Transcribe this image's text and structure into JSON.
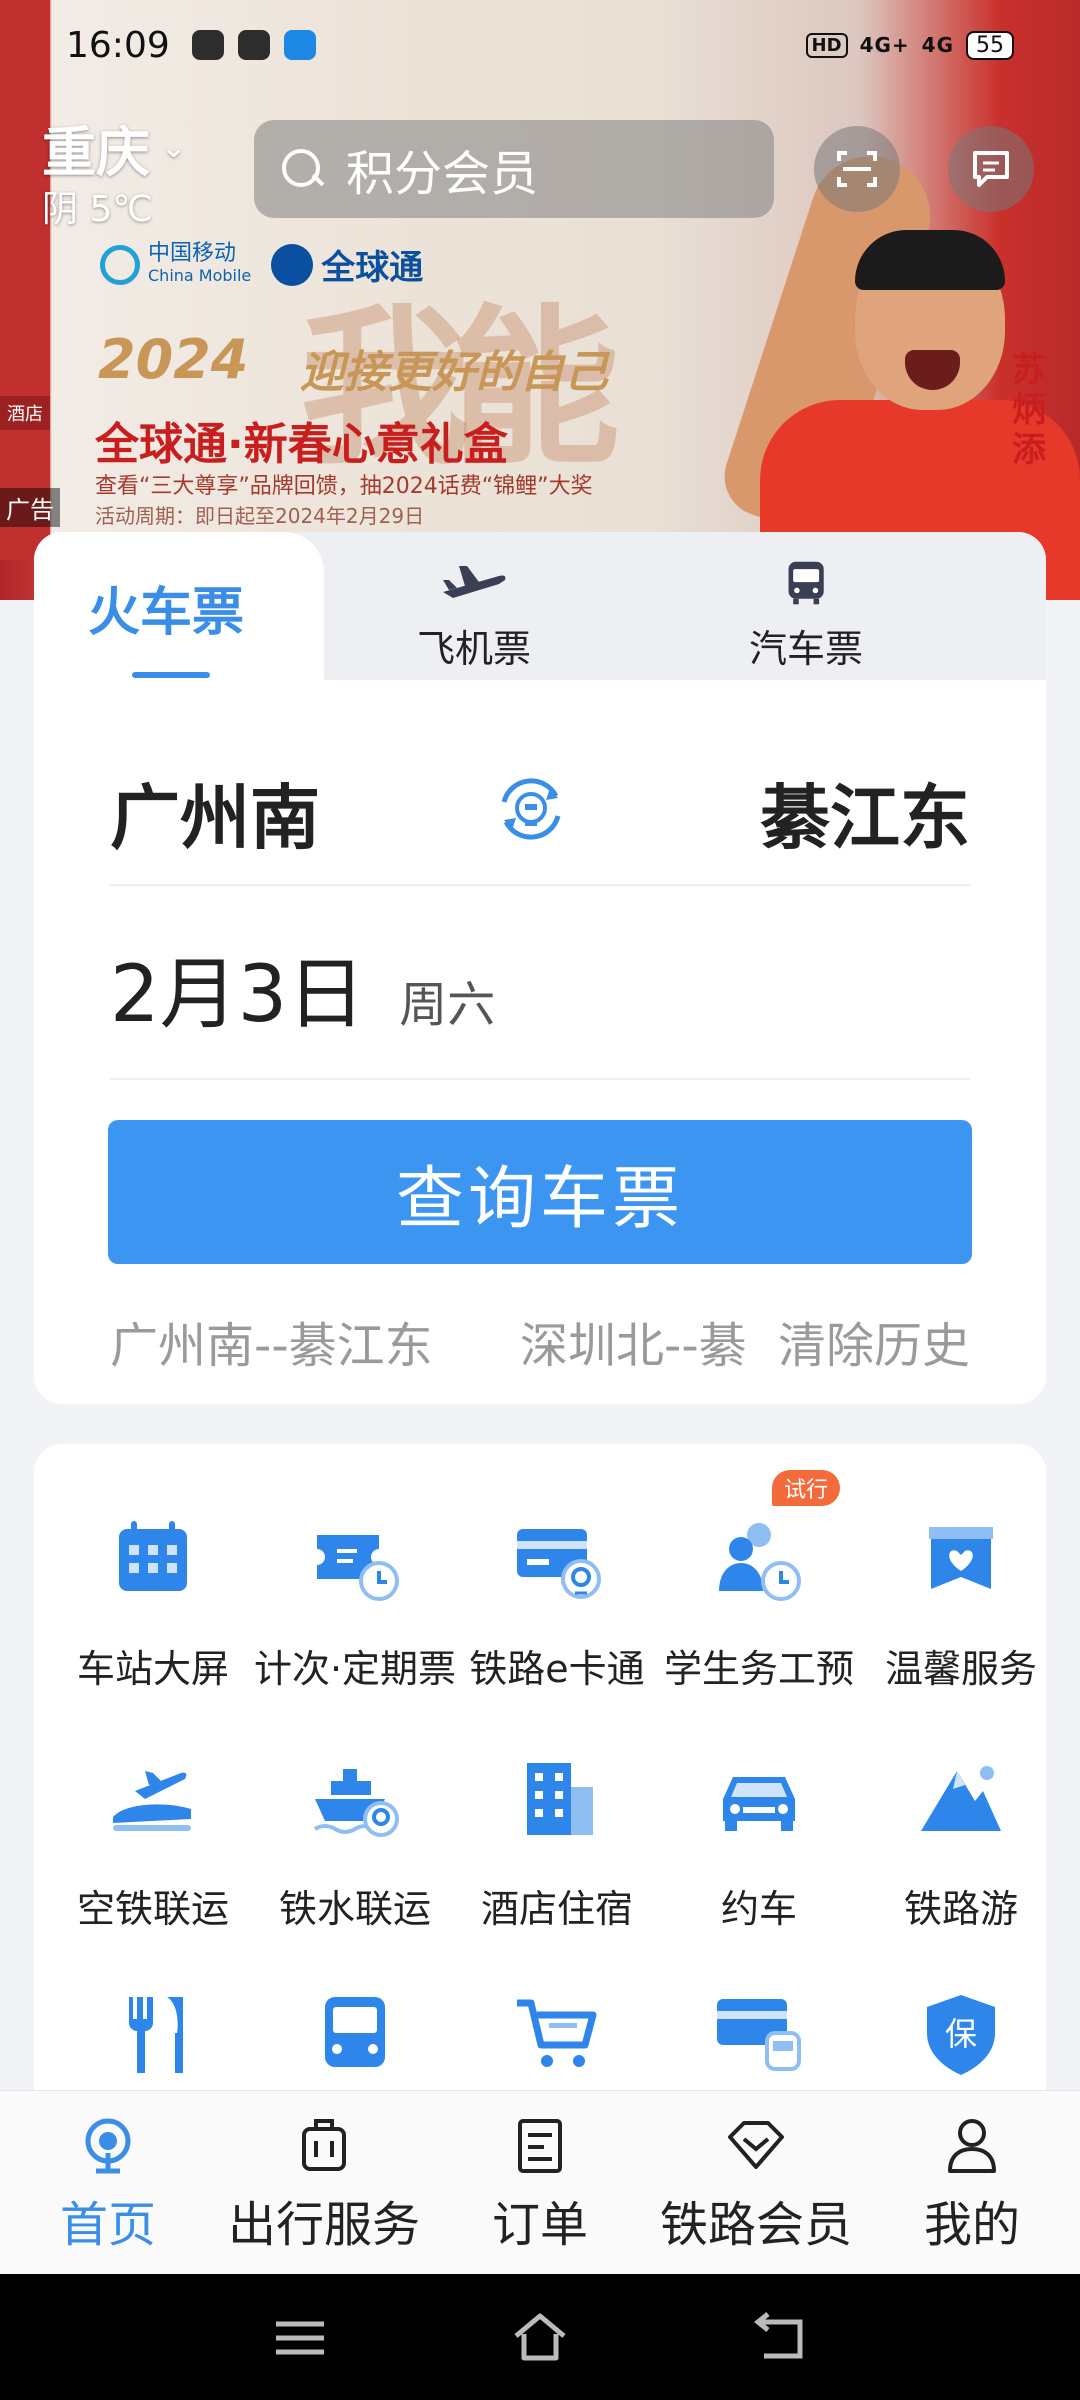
{
  "status_bar": {
    "time": "16:09",
    "hd": "HD",
    "signal_1": "4G+",
    "signal_2": "4G",
    "battery": "55"
  },
  "location": {
    "city": "重庆",
    "weather": "阴 5℃"
  },
  "search": {
    "placeholder": "积分会员"
  },
  "banner": {
    "left_tags": [
      "酒店",
      "广告"
    ],
    "brand_1": "中国移动",
    "brand_1_en": "China Mobile",
    "brand_2": "全球通",
    "big_chars": "我能",
    "year": "2024",
    "slogan": "迎接更好的自己",
    "headline": "全球通·新春心意礼盒",
    "sub": "查看“三大尊享”品牌回馈，抽2024话费“锦鲤”大奖",
    "period": "活动周期：即日起至2024年2月29日",
    "athlete_name": "苏炳添",
    "ad_label": "广告"
  },
  "ticket": {
    "tabs": [
      {
        "label": "火车票"
      },
      {
        "label": "飞机票",
        "icon": "plane-icon"
      },
      {
        "label": "汽车票",
        "icon": "bus-icon"
      }
    ],
    "from": "广州南",
    "to": "綦江东",
    "date": "2月3日",
    "weekday": "周六",
    "query_button": "查询车票",
    "history": [
      "广州南--綦江东",
      "深圳北--綦"
    ],
    "clear_history": "清除历史"
  },
  "services": {
    "badge": "试行",
    "items": [
      {
        "label": "车站大屏",
        "icon": "calendar-grid-icon"
      },
      {
        "label": "计次·定期票",
        "icon": "ticket-clock-icon"
      },
      {
        "label": "铁路e卡通",
        "icon": "card-train-icon"
      },
      {
        "label": "学生务工预",
        "icon": "people-clock-icon"
      },
      {
        "label": "温馨服务",
        "icon": "heart-box-icon"
      },
      {
        "label": "空铁联运",
        "icon": "plane-train-icon"
      },
      {
        "label": "铁水联运",
        "icon": "ship-icon"
      },
      {
        "label": "酒店住宿",
        "icon": "building-icon"
      },
      {
        "label": "约车",
        "icon": "car-icon"
      },
      {
        "label": "铁路游",
        "icon": "mountain-icon"
      },
      {
        "label": "",
        "icon": "fork-knife-icon"
      },
      {
        "label": "",
        "icon": "bus-front-icon"
      },
      {
        "label": "",
        "icon": "cart-icon"
      },
      {
        "label": "",
        "icon": "card-train-2-icon"
      },
      {
        "label": "保",
        "icon": "shield-bao-icon"
      }
    ]
  },
  "bottom_nav": [
    {
      "label": "首页",
      "active": true
    },
    {
      "label": "出行服务"
    },
    {
      "label": "订单"
    },
    {
      "label": "铁路会员"
    },
    {
      "label": "我的"
    }
  ],
  "colors": {
    "accent": "#3a8ee8",
    "button": "#3d95f2",
    "badge": "#f36b3b"
  }
}
